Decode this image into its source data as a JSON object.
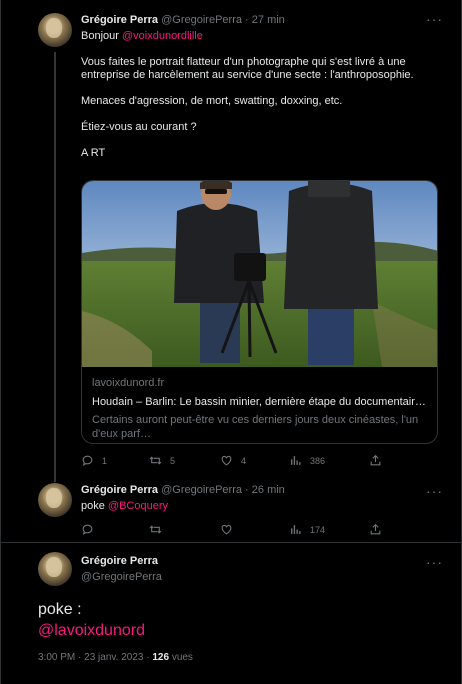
{
  "tweet1": {
    "name": "Grégoire Perra",
    "handle": "@GregoirePerra",
    "sep": "·",
    "time": "27 min",
    "greeting": "Bonjour ",
    "greeting_mention": "@voixdunordlille",
    "para1": "Vous faites le portrait flatteur d'un photographe qui s'est livré à une entreprise de harcèlement au service d'une secte : l'anthroposophie.",
    "para2": "Menaces d'agression, de mort, swatting, doxxing, etc.",
    "para3": "Étiez-vous au courant ?",
    "para4": "A RT",
    "card": {
      "domain": "lavoixdunord.fr",
      "title": "Houdain – Barlin: Le bassin minier, dernière étape du documentaire «L…",
      "description": "Certains auront peut-être vu ces derniers jours deux cinéastes, l'un d'eux parf…"
    },
    "actions": {
      "reply": "1",
      "retweet": "5",
      "like": "4",
      "views": "386"
    }
  },
  "tweet2": {
    "name": "Grégoire Perra",
    "handle": "@GregoirePerra",
    "sep": "·",
    "time": "26 min",
    "text": "poke ",
    "mention": "@BCoquery",
    "actions": {
      "views": "174"
    }
  },
  "tweet3": {
    "name": "Grégoire Perra",
    "handle": "@GregoirePerra",
    "text": "poke :",
    "mention": "@lavoixdunord",
    "time": "3:00 PM",
    "date": "23 janv. 2023",
    "views_count": "126",
    "views_label": "vues"
  },
  "colors": {
    "background": "#000000",
    "text": "#e7e9ea",
    "muted": "#71767b",
    "mention": "#f91880",
    "border": "#2f3336"
  },
  "icons": [
    "more-icon",
    "reply-icon",
    "retweet-icon",
    "like-icon",
    "views-icon",
    "share-icon"
  ]
}
